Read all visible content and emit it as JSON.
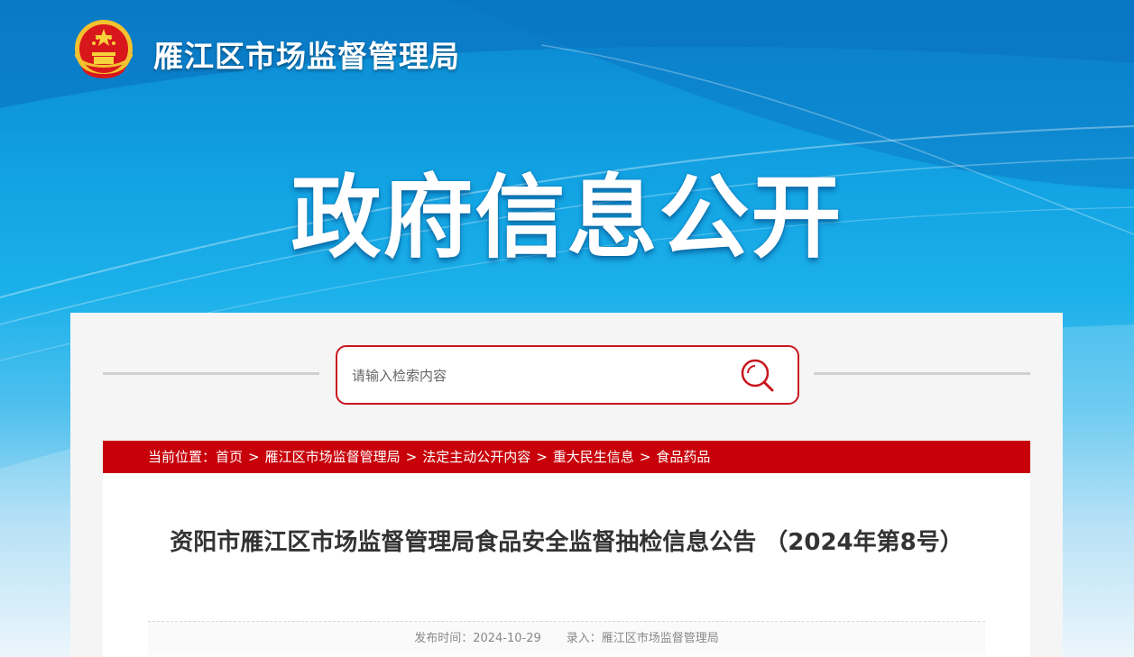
{
  "header": {
    "org_name": "雁江区市场监督管理局",
    "banner_title": "政府信息公开"
  },
  "search": {
    "placeholder": "请输入检索内容",
    "icon": "search-icon"
  },
  "breadcrumb": {
    "prefix": "当前位置：",
    "separator": ">",
    "items": [
      "首页",
      "雁江区市场监督管理局",
      "法定主动公开内容",
      "重大民生信息",
      "食品药品"
    ]
  },
  "article": {
    "title": "资阳市雁江区市场监督管理局食品安全监督抽检信息公告 （2024年第8号）",
    "publish_label": "发布时间：",
    "publish_date": "2024-10-29",
    "entry_label": "录入：",
    "entry_value": "雁江区市场监督管理局"
  },
  "colors": {
    "accent_red": "#c8000a",
    "banner_blue": "#12a3e3"
  }
}
